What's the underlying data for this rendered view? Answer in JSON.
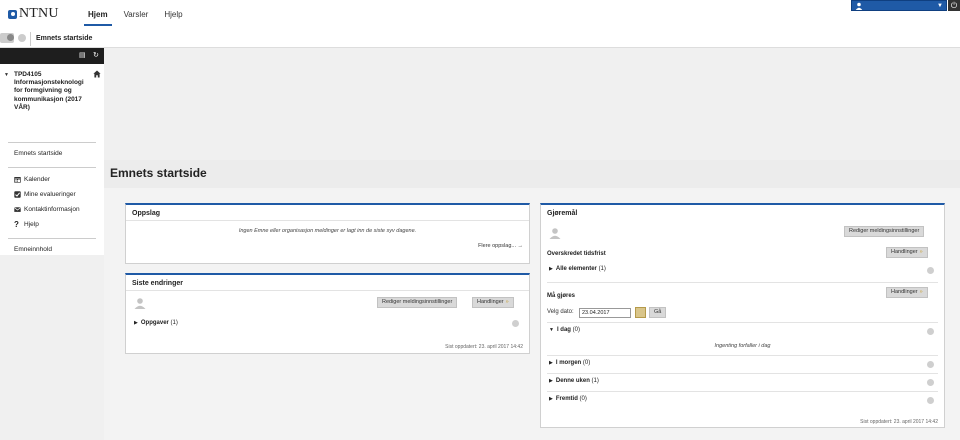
{
  "app": {
    "logo_text": "NTNU"
  },
  "nav": {
    "tabs": [
      "Hjem",
      "Varsler",
      "Hjelp"
    ],
    "active": "Hjem"
  },
  "breadcrumb": {
    "current": "Emnets startside"
  },
  "sidebar": {
    "course_title": "TPD4105 Informasjonsteknologi for formgivning og kommunikasjon (2017 VÅR)",
    "home_link": "Emnets startside",
    "tools": [
      {
        "label": "Kalender",
        "icon": "calendar-icon"
      },
      {
        "label": "Mine evalueringer",
        "icon": "checkbox-icon"
      },
      {
        "label": "Kontaktinformasjon",
        "icon": "envelope-icon"
      },
      {
        "label": "Hjelp",
        "icon": "question-icon"
      }
    ],
    "content_link": "Emneinnhold"
  },
  "page": {
    "title": "Emnets startside"
  },
  "oppslag": {
    "title": "Oppslag",
    "empty": "Ingen Emne eller organisasjon meldinger er lagt inn de siste syv dagene.",
    "more": "Flere oppslag... →"
  },
  "siste": {
    "title": "Siste endringer",
    "edit_btn": "Rediger meldingsinnstillinger",
    "actions_btn": "Handlinger",
    "item_label": "Oppgaver",
    "item_count": "(1)",
    "updated": "Sist oppdatert: 23. april 2017 14:42"
  },
  "gjoremal": {
    "title": "Gjøremål",
    "edit_btn": "Rediger meldingsinnstillinger",
    "actions_btn": "Handlinger",
    "overdue_label": "Overskredet tidsfrist",
    "all_label": "Alle elementer",
    "all_count": "(1)",
    "due_label": "Må gjøres",
    "date_label": "Velg dato:",
    "date_value": "23.04.2017",
    "go_btn": "Gå",
    "today_label": "I dag",
    "today_count": "(0)",
    "nothing_today": "Ingenting forfaller i dag",
    "tomorrow_label": "I morgen",
    "tomorrow_count": "(0)",
    "week_label": "Denne uken",
    "week_count": "(1)",
    "future_label": "Fremtid",
    "future_count": "(0)",
    "updated": "Sist oppdatert: 23. april 2017 14:42"
  },
  "colors": {
    "accent": "#1f5aa6",
    "toolbar": "#1e1e1e"
  }
}
